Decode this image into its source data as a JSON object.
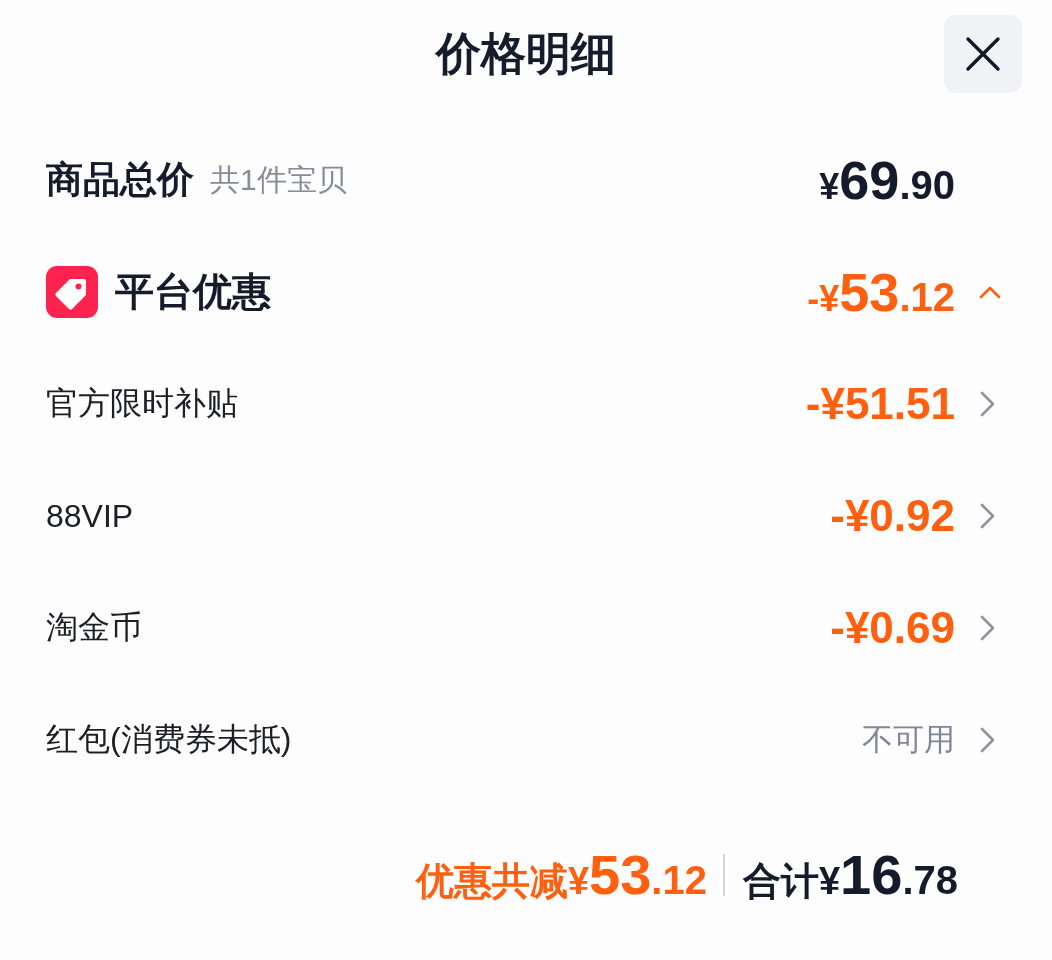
{
  "header": {
    "title": "价格明细"
  },
  "total": {
    "label": "商品总价",
    "note": "共1件宝贝",
    "price": "¥69.90"
  },
  "platform_discount": {
    "label": "平台优惠",
    "amount": "-¥53.12",
    "expanded": true
  },
  "discounts": [
    {
      "label": "官方限时补贴",
      "kind": "amount",
      "value": "-¥51.51"
    },
    {
      "label": "88VIP",
      "kind": "amount",
      "value": "-¥0.92"
    },
    {
      "label": "淘金币",
      "kind": "amount",
      "value": "-¥0.69"
    },
    {
      "label": "红包(消费券未抵)",
      "kind": "status",
      "value": "不可用"
    }
  ],
  "summary": {
    "saved": "优惠共减¥53.12",
    "total": "合计¥16.78"
  }
}
